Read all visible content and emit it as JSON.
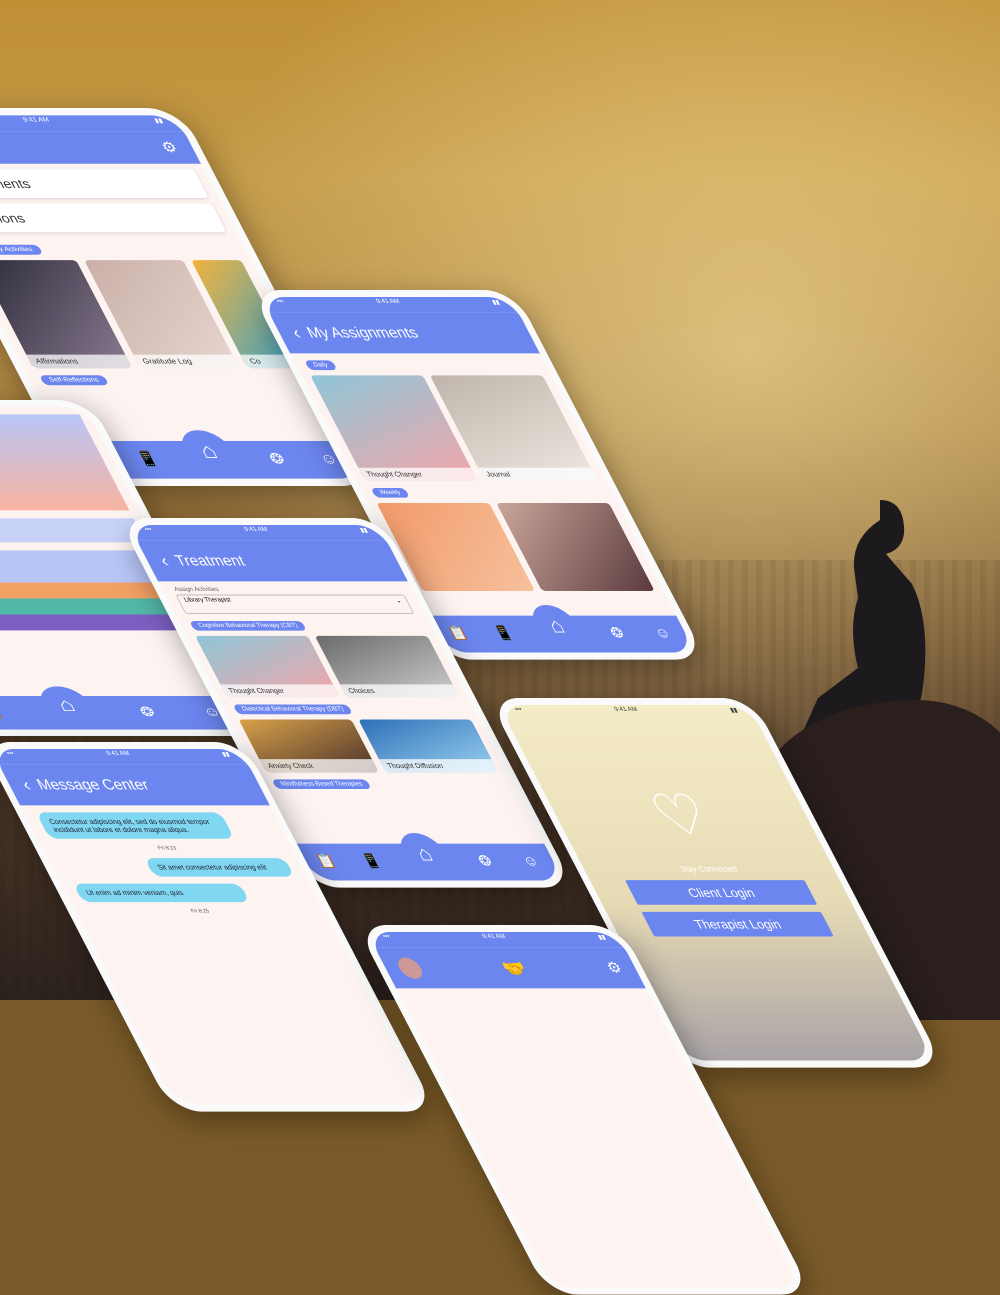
{
  "colors": {
    "accent": "#6c86f0",
    "screen_bg": "#fdf4f1",
    "bubble_blue": "#7fd7f2"
  },
  "phone_home": {
    "rows": [
      "Assignments",
      "Sessions"
    ],
    "section_label": "Library Activities",
    "tiles": [
      "Affirmations",
      "Gratitude Log",
      "Co"
    ],
    "bottom_label": "Self-Reflections"
  },
  "phone_assignments": {
    "title": "My Assignments",
    "section1": "Daily",
    "tiles1": [
      "Thought Changer",
      "Journal"
    ],
    "section2": "Weekly"
  },
  "phone_treatment": {
    "title": "Treatment",
    "select_label": "Assign Activities",
    "select_value": "Library Therapist",
    "section1": "Cognitive Behavioral Therapy (CBT)",
    "tiles1": [
      "Thought Changer",
      "Choices"
    ],
    "section2": "Dialectical Behavioral Therapy (DBT)",
    "tiles2": [
      "Anxiety Check",
      "Thought Diffusion"
    ],
    "section3": "Mindfulness-Based Therapies"
  },
  "phone_messages": {
    "title": "Message Center",
    "msg1": "Consectetur adipiscing elit, sed do eiusmod tempor incididunt ut labore et dolore magna aliqua.",
    "time1": "Fri 8:23",
    "msg2": "Sit amet consectetur adipiscing elit",
    "msg3": "Ut enim ad minim veniam, quis",
    "time3": "Fri 8:25"
  },
  "phone_login": {
    "tagline": "Stay Connected",
    "client_button": "Client Login",
    "therapist_button": "Therapist Login"
  }
}
